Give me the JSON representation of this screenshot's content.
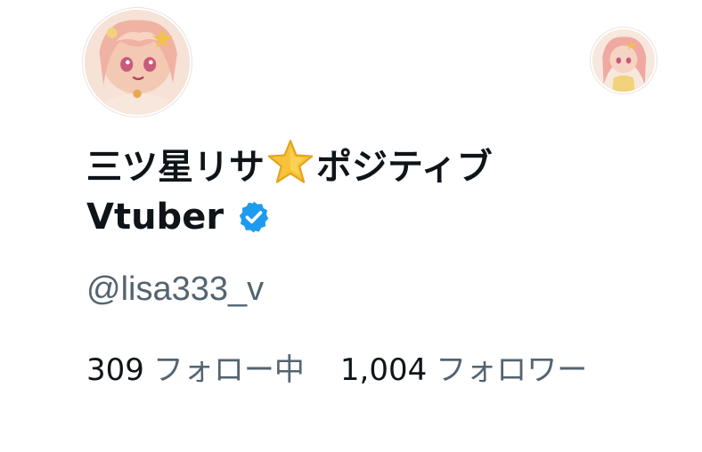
{
  "profile": {
    "name_line1_part1": "三ツ星リサ",
    "name_line1_part2": "ポジティブ",
    "name_line2": "Vtuber",
    "handle": "@lisa333_v",
    "star_icon": "star-emoji",
    "verified_icon": "verified-badge-icon",
    "verified_color": "#1d9bf0"
  },
  "stats": {
    "following_count": "309",
    "following_label": "フォロー中",
    "followers_count": "1,004",
    "followers_label": "フォロワー"
  },
  "colors": {
    "text_primary": "#0f1419",
    "text_secondary": "#536471",
    "accent": "#1d9bf0"
  }
}
